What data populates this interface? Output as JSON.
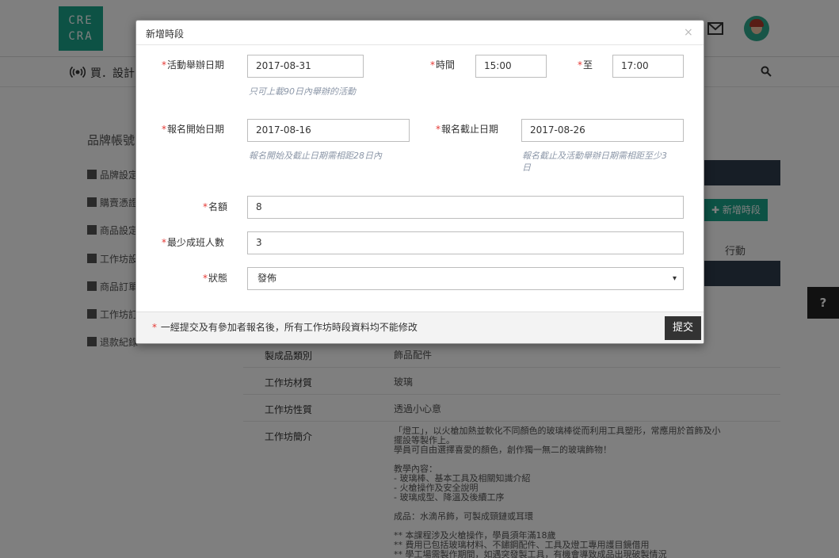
{
  "background": {
    "logo_line1": "CRE",
    "logo_line2": "CRA",
    "nav_title": "買．設計",
    "sidebar_title": "品牌帳號",
    "sidebar_items": [
      "品牌設定",
      "購賣憑證",
      "商品設定",
      "工作坊設定",
      "商品訂單",
      "工作坊訂單",
      "退款紀錄"
    ],
    "add_session_label": "新增時段",
    "action_header": "行動",
    "help_label": "?",
    "info_rows": [
      {
        "key": "製成品類別",
        "value": "飾品配件"
      },
      {
        "key": "工作坊材質",
        "value": "玻璃"
      },
      {
        "key": "工作坊性質",
        "value": "透過小心意"
      }
    ],
    "intro_key": "工作坊簡介",
    "intro_lines": [
      "「燈工」，以火槍加熱並軟化不同顏色的玻璃棒從而利用工具塑形，常應用於首飾及小",
      "擺設等製作上。",
      "學員可自由選擇喜愛的顏色，創作獨一無二的玻璃飾物！",
      "",
      "教學內容：",
      "- 玻璃棒、基本工具及相關知識介紹",
      "- 火槍操作及安全說明",
      "- 玻璃成型、降溫及後續工序",
      "",
      "成品：水滴吊飾，可製成頸鏈或耳環",
      "",
      "** 本課程涉及火槍操作，學員須年滿18歲",
      "** 費用已包括玻璃材料、不鏽鋼配件、工具及燈工專用護目鏡借用",
      "** 學工場需製作期間，如遇突發製工具，有機會導致成品出現破製情況"
    ]
  },
  "modal": {
    "title": "新增時段",
    "close_label": "×",
    "required_mark": "*",
    "event_date_label": "活動舉辦日期",
    "event_date_value": "2017-08-31",
    "event_date_hint": "只可上載90日內舉辦的活動",
    "time_label": "時間",
    "time_start_value": "15:00",
    "time_to_label": "至",
    "time_end_value": "17:00",
    "reg_start_label": "報名開始日期",
    "reg_start_value": "2017-08-16",
    "reg_start_hint": "報名開始及截止日期需相距28日內",
    "reg_end_label": "報名截止日期",
    "reg_end_value": "2017-08-26",
    "reg_end_hint_line1": "報名截止及活動舉辦日期需相距至少3",
    "reg_end_hint_line2": "日",
    "quota_label": "名額",
    "quota_value": "8",
    "min_label": "最少成班人數",
    "min_value": "3",
    "status_label": "狀態",
    "status_value": "發佈",
    "status_arrow": "▾",
    "footer_note": "一經提交及有參加者報名後，所有工作坊時段資料均不能修改",
    "submit_label": "提交"
  }
}
